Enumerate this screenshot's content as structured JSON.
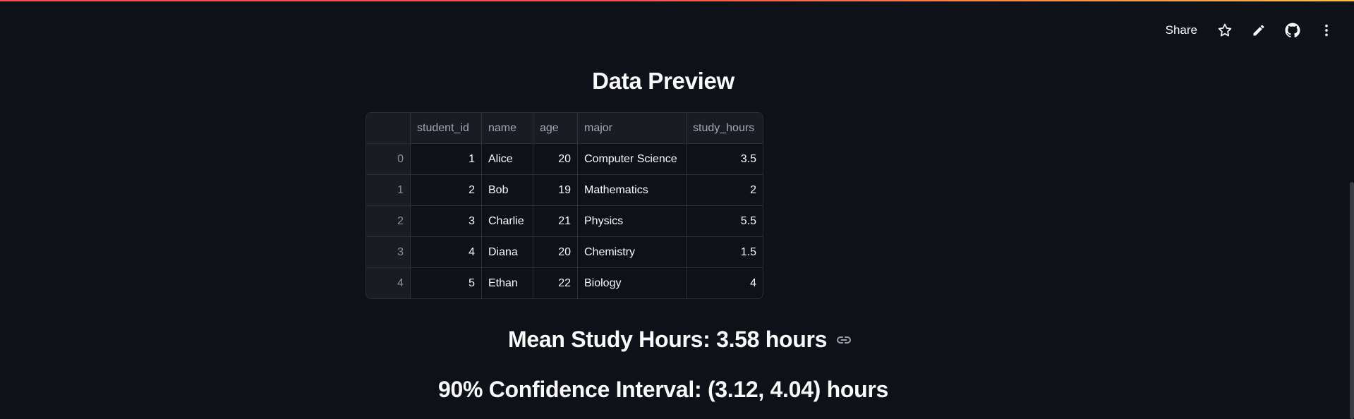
{
  "header": {
    "share_label": "Share",
    "icons": [
      "star-icon",
      "pencil-icon",
      "github-icon",
      "more-vertical-icon"
    ]
  },
  "main": {
    "title": "Data Preview",
    "table": {
      "columns": [
        "",
        "student_id",
        "name",
        "age",
        "major",
        "study_hours"
      ],
      "rows": [
        [
          "0",
          "1",
          "Alice",
          "20",
          "Computer Science",
          "3.5"
        ],
        [
          "1",
          "2",
          "Bob",
          "19",
          "Mathematics",
          "2"
        ],
        [
          "2",
          "3",
          "Charlie",
          "21",
          "Physics",
          "5.5"
        ],
        [
          "3",
          "4",
          "Diana",
          "20",
          "Chemistry",
          "1.5"
        ],
        [
          "4",
          "5",
          "Ethan",
          "22",
          "Biology",
          "4"
        ]
      ]
    },
    "mean_heading": "Mean Study Hours: 3.58 hours",
    "ci_heading": "90% Confidence Interval: (3.12, 4.04) hours"
  },
  "colors": {
    "background": "#0e1117",
    "accent_start": "#ff4b4b",
    "accent_end": "#ffbd45",
    "text": "#fafafa"
  }
}
